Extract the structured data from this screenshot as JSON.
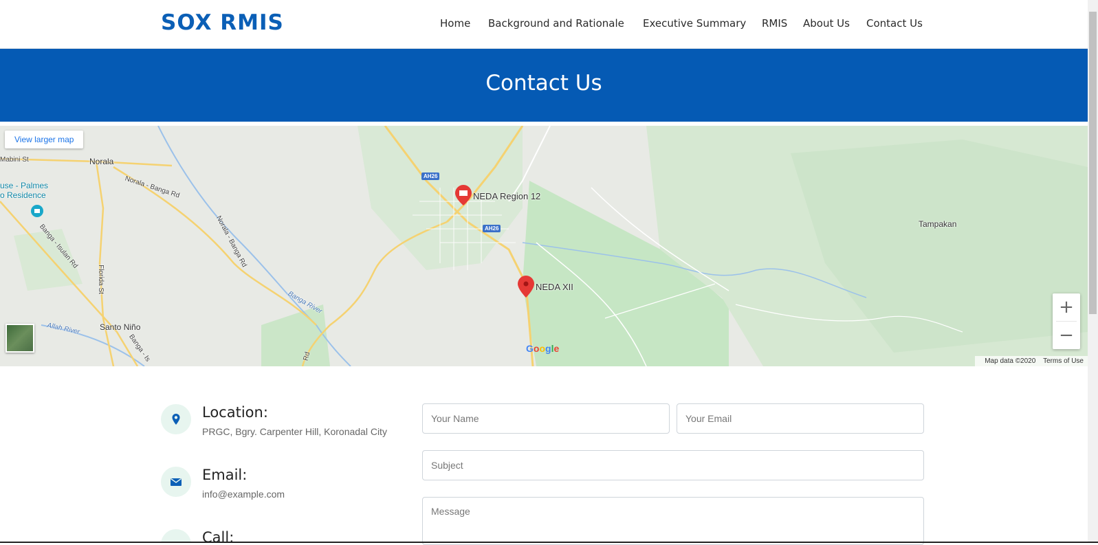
{
  "header": {
    "logo": "SOX RMIS",
    "nav": [
      "Home",
      "Background and Rationale",
      "Executive Summary",
      "RMIS",
      "About Us",
      "Contact Us"
    ]
  },
  "banner": {
    "title": "Contact Us"
  },
  "map": {
    "view_larger": "View larger map",
    "places": [
      "NEDA Region 12",
      "NEDA XII",
      "Norala",
      "Tampakan",
      "Santo Niño",
      "use - Palmes",
      "o Residence"
    ],
    "roads": [
      "Mabini St",
      "Norala - Banga Rd",
      "Norala - Banga Rd",
      "Banga - Isulan Rd",
      "Florida St",
      "Banga - Is",
      "Rd",
      "AH26",
      "AH26"
    ],
    "rivers": [
      "Banga River",
      "Allah River"
    ],
    "attribution": [
      "Map data ©2020",
      "Terms of Use"
    ],
    "logo": "Google",
    "zoom_in": "+",
    "zoom_out": "−"
  },
  "contact": {
    "location": {
      "title": "Location:",
      "text": "PRGC, Bgry. Carpenter Hill, Koronadal City"
    },
    "email": {
      "title": "Email:",
      "text": "info@example.com"
    },
    "call": {
      "title": "Call:"
    }
  },
  "form": {
    "name_placeholder": "Your Name",
    "email_placeholder": "Your Email",
    "subject_placeholder": "Subject",
    "message_placeholder": "Message"
  },
  "colors": {
    "brand": "#0b5fb6",
    "banner": "#055ab4",
    "icon_bg": "#e7f5ef"
  }
}
